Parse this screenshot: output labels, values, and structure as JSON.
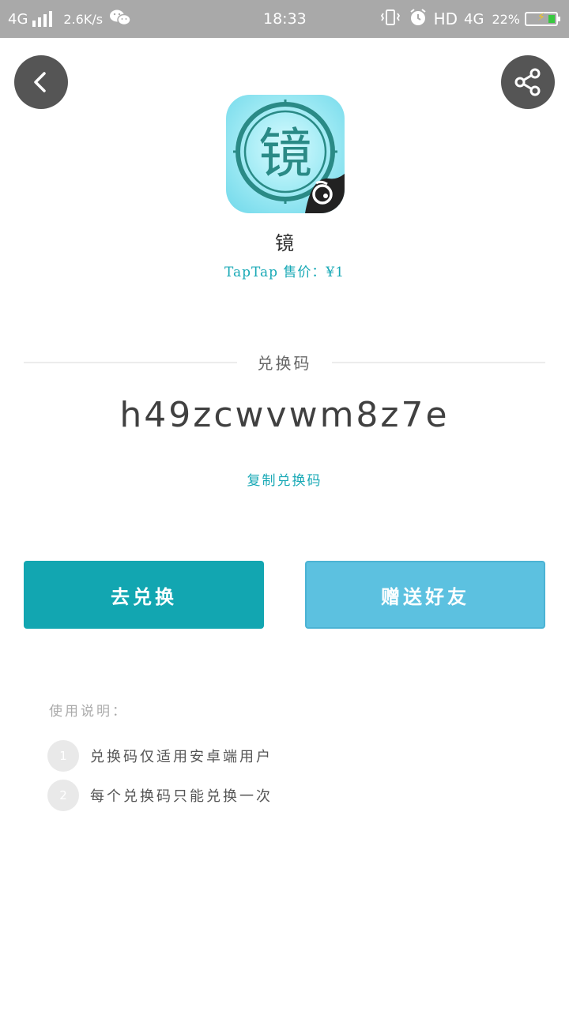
{
  "status_bar": {
    "network_left": "4G",
    "speed": "2.6K/s",
    "time": "18:33",
    "hd": "HD",
    "network_right": "4G",
    "battery": "22%"
  },
  "app": {
    "name": "镜",
    "price": "TapTap 售价：¥1",
    "icon_glyph": "镜",
    "icon_colors": {
      "bg": "#8fe3f0",
      "ring": "#2a8a86",
      "badge": "#222222"
    }
  },
  "code_section": {
    "title": "兑换码",
    "code": "h49zcwvwm8z7e",
    "copy_label": "复制兑换码"
  },
  "buttons": {
    "redeem": "去兑换",
    "gift": "赠送好友"
  },
  "instructions": {
    "title": "使用说明：",
    "items": [
      {
        "num": "1",
        "text": "兑换码仅适用安卓端用户"
      },
      {
        "num": "2",
        "text": "每个兑换码只能兑换一次"
      }
    ]
  },
  "colors": {
    "accent": "#12a6b1",
    "secondary": "#5cc1e0",
    "status_bar": "#a9a9a9"
  }
}
